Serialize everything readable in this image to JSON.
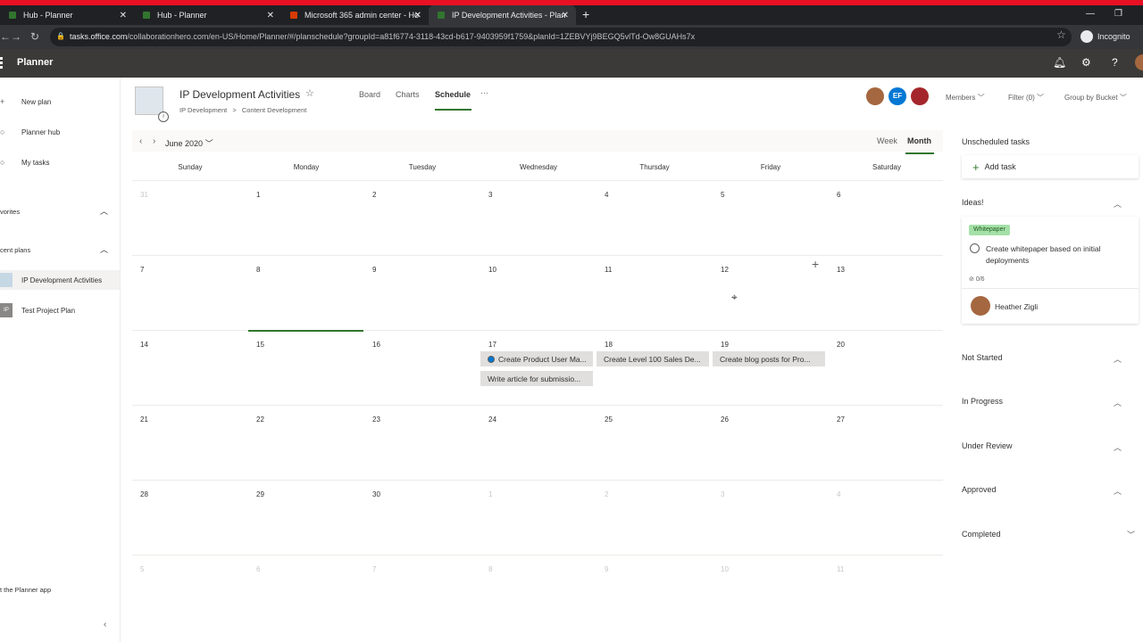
{
  "browser": {
    "tabs": [
      {
        "title": "Hub - Planner"
      },
      {
        "title": "Hub - Planner"
      },
      {
        "title": "Microsoft 365 admin center - Ho"
      },
      {
        "title": "IP Development Activities - Plan"
      }
    ],
    "url_host": "tasks.office.com",
    "url_path": "/collaborationhero.com/en-US/Home/Planner/#/planschedule?groupId=a81f6774-3118-43cd-b617-9403959f1759&planId=1ZEBVYj9BEGQ5vlTd-Ow8GUAHs7x",
    "profile": "Incognito"
  },
  "suite": {
    "app_name": "Planner"
  },
  "sidebar": {
    "items": [
      {
        "label": "New plan"
      },
      {
        "label": "Planner hub"
      },
      {
        "label": "My tasks"
      }
    ],
    "favorites_label": "vorites",
    "recent_label": "cent plans",
    "recent_plans": [
      {
        "label": "IP Development Activities",
        "icon": ""
      },
      {
        "label": "Test Project Plan",
        "icon": "IP"
      }
    ],
    "get_app": "t the Planner app"
  },
  "header": {
    "plan_name": "IP Development Activities",
    "breadcrumb_group": "IP Development",
    "breadcrumb_sep": ">",
    "breadcrumb_page": "Content Development",
    "tabs": {
      "board": "Board",
      "charts": "Charts",
      "schedule": "Schedule",
      "more": "···"
    },
    "avatar_initials": "EF",
    "members": "Members",
    "filter": "Filter (0)",
    "group_by": "Group by Bucket"
  },
  "calendar": {
    "month": "June 2020",
    "view_week": "Week",
    "view_month": "Month",
    "days_of_week": [
      "Sunday",
      "Monday",
      "Tuesday",
      "Wednesday",
      "Thursday",
      "Friday",
      "Saturday"
    ],
    "weeks": [
      [
        "31",
        "1",
        "2",
        "3",
        "4",
        "5",
        "6"
      ],
      [
        "7",
        "8",
        "9",
        "10",
        "11",
        "12",
        "13"
      ],
      [
        "14",
        "15",
        "16",
        "17",
        "18",
        "19",
        "20"
      ],
      [
        "21",
        "22",
        "23",
        "24",
        "25",
        "26",
        "27"
      ],
      [
        "28",
        "29",
        "30",
        "1",
        "2",
        "3",
        "4"
      ],
      [
        "5",
        "6",
        "7",
        "8",
        "9",
        "10",
        "11"
      ]
    ],
    "tasks": [
      {
        "label": "Create Product User Ma..."
      },
      {
        "label": "Create Level 100 Sales De..."
      },
      {
        "label": "Create blog posts for Pro..."
      },
      {
        "label": "Write article for submissio..."
      }
    ]
  },
  "panel": {
    "title": "Unscheduled tasks",
    "add_task": "Add task",
    "buckets": [
      {
        "name": "Ideas!"
      },
      {
        "name": "Not Started"
      },
      {
        "name": "In Progress"
      },
      {
        "name": "Under Review"
      },
      {
        "name": "Approved"
      },
      {
        "name": "Completed"
      }
    ],
    "card": {
      "label": "Whitepaper",
      "title": "Create whitepaper based on initial deployments",
      "checklist": "0/6",
      "assignee": "Heather Zigli"
    }
  },
  "colors": {
    "accent": "#31752f",
    "suitebar": "#3b3a39",
    "browser_accent": "#e81123"
  }
}
